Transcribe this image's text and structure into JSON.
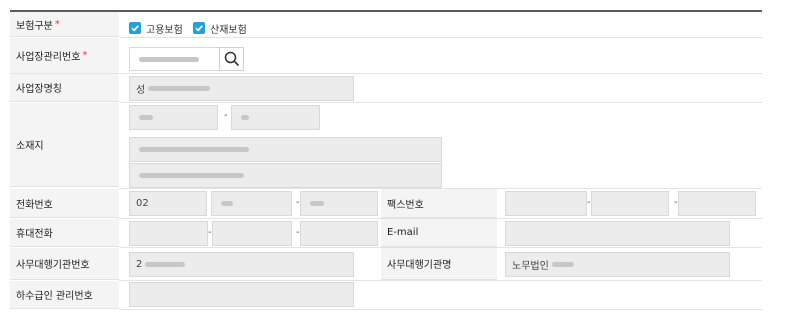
{
  "insurance_type": {
    "label": "보험구분",
    "required_mark": "*",
    "options": [
      {
        "label": "고용보험",
        "checked": true
      },
      {
        "label": "산재보험",
        "checked": true
      }
    ]
  },
  "business_number": {
    "label": "사업장관리번호",
    "required_mark": "*",
    "search_icon": "search-icon"
  },
  "business_name": {
    "label": "사업장명칭",
    "value_prefix": "성"
  },
  "address": {
    "label": "소재지",
    "dash": "-"
  },
  "phone": {
    "label": "전화번호",
    "area_code": "02",
    "dash": "-"
  },
  "fax": {
    "label": "팩스번호",
    "dash": "-"
  },
  "mobile": {
    "label": "휴대전화",
    "dash": "-"
  },
  "email": {
    "label": "E-mail"
  },
  "agency_number": {
    "label": "사무대행기관번호",
    "value_prefix": "2"
  },
  "agency_name": {
    "label": "사무대행기관명",
    "value_prefix": "노무법인"
  },
  "sewer_number": {
    "label": "하수급인 관리번호"
  },
  "colors": {
    "checkbox": "#2a9fd8",
    "required": "#e0383e",
    "label_bg": "#f4f4f4",
    "field_bg": "#ececec"
  }
}
